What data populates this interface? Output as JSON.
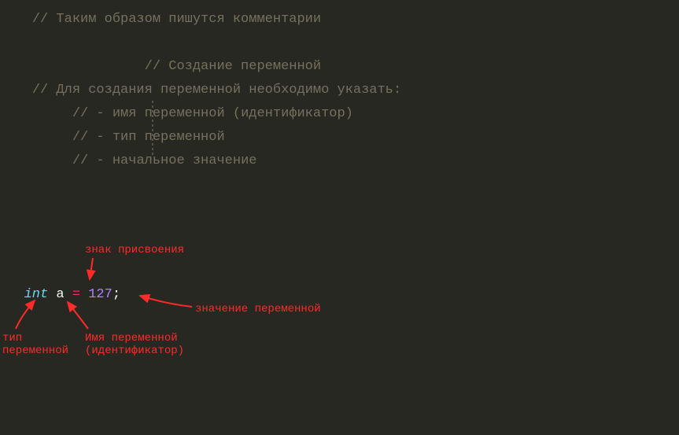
{
  "comments": {
    "l1": "// Таким образом пишутся комментарии",
    "l2": "// Создание переменной",
    "l3": "// Для создания переменной необходимо указать:",
    "l4": "// - имя переменной (идентификатор)",
    "l5": "// - тип переменной",
    "l6": "// - начальное значение"
  },
  "code": {
    "kw_int": "int",
    "space1": " ",
    "ident_a": "a",
    "space2": " ",
    "assign": "=",
    "space3": " ",
    "num": "127",
    "semi": ";"
  },
  "annotations": {
    "assign_label": "знак присвоения",
    "value_label": "значение переменной",
    "type_label_l1": "тип",
    "type_label_l2": "переменной",
    "name_label_l1": "Имя переменной",
    "name_label_l2": "(идентификатор)"
  }
}
